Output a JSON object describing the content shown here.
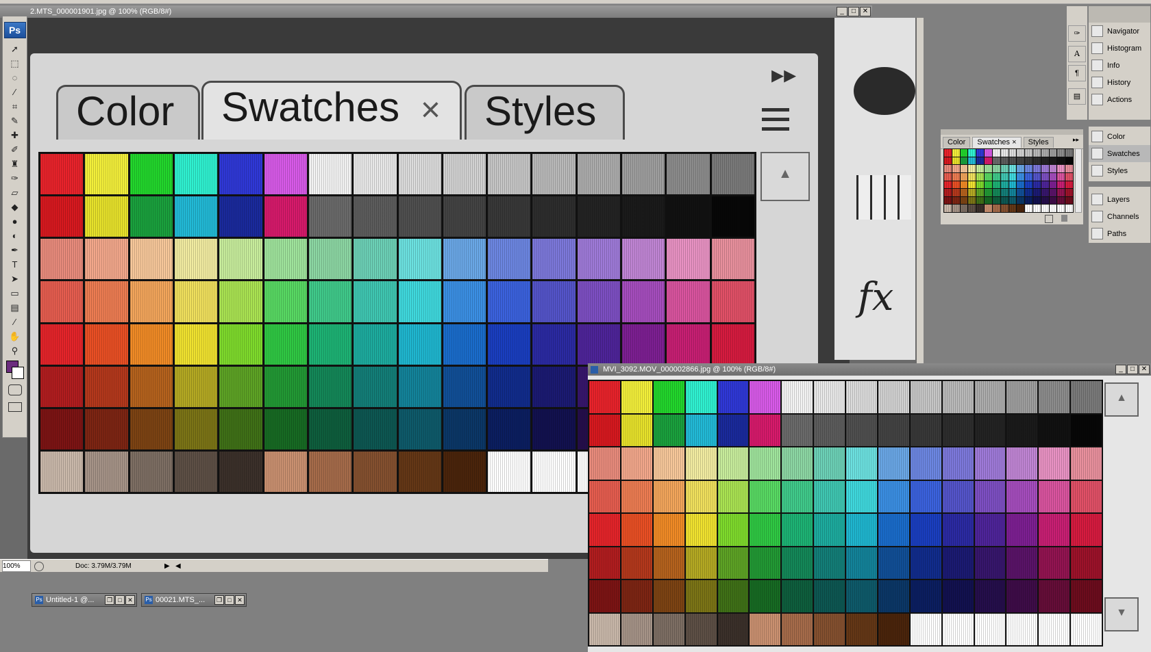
{
  "doc1": {
    "title": "2.MTS_000001901.jpg @ 100% (RGB/8#)",
    "tabs": [
      "Color",
      "Swatches",
      "Styles"
    ],
    "tab_close": "×",
    "panel_menu_glyph": "▸▸",
    "zoom": "100%",
    "doc_info": "Doc: 3.79M/3.79M"
  },
  "doc2": {
    "title": "MVI_3092.MOV_000002866.jpg @ 100% (RGB/8#)"
  },
  "window_buttons": {
    "minimize": "_",
    "maximize": "□",
    "close": "✕"
  },
  "toolbar": {
    "logo": "Ps",
    "tools": [
      {
        "name": "move-tool-icon",
        "glyph": "➚"
      },
      {
        "name": "marquee-tool-icon",
        "glyph": "⬚"
      },
      {
        "name": "lasso-tool-icon",
        "glyph": "◌"
      },
      {
        "name": "magic-wand-tool-icon",
        "glyph": "⁄"
      },
      {
        "name": "crop-tool-icon",
        "glyph": "⌗"
      },
      {
        "name": "slice-tool-icon",
        "glyph": "✎"
      },
      {
        "name": "healing-tool-icon",
        "glyph": "✚"
      },
      {
        "name": "brush-tool-icon",
        "glyph": "✐"
      },
      {
        "name": "stamp-tool-icon",
        "glyph": "♜"
      },
      {
        "name": "history-brush-icon",
        "glyph": "✑"
      },
      {
        "name": "eraser-tool-icon",
        "glyph": "▱"
      },
      {
        "name": "bucket-tool-icon",
        "glyph": "◆"
      },
      {
        "name": "blur-tool-icon",
        "glyph": "●"
      },
      {
        "name": "dodge-tool-icon",
        "glyph": "◐"
      },
      {
        "name": "pen-tool-icon",
        "glyph": "✒"
      },
      {
        "name": "type-tool-icon",
        "glyph": "T"
      },
      {
        "name": "path-select-icon",
        "glyph": "➤"
      },
      {
        "name": "shape-tool-icon",
        "glyph": "▭"
      },
      {
        "name": "notes-tool-icon",
        "glyph": "▤"
      },
      {
        "name": "eyedropper-tool-icon",
        "glyph": "⁄"
      },
      {
        "name": "hand-tool-icon",
        "glyph": "✋"
      },
      {
        "name": "zoom-tool-icon",
        "glyph": "⚲"
      }
    ]
  },
  "dock": {
    "group1": [
      "Navigator",
      "Histogram",
      "Info",
      "History",
      "Actions"
    ],
    "group2": [
      "Color",
      "Swatches",
      "Styles"
    ],
    "group3": [
      "Layers",
      "Channels",
      "Paths"
    ],
    "selected": "Swatches"
  },
  "mini_panel": {
    "tabs": [
      "Color",
      "Swatches",
      "Styles"
    ],
    "tab_close": "×"
  },
  "taskbar": [
    {
      "title": "Untitled-1 @..."
    },
    {
      "title": "00021.MTS_..."
    }
  ],
  "colors": {
    "row1": [
      "#e8232b",
      "#f2ee3a",
      "#22d52c",
      "#2ff0d0",
      "#2f38d6",
      "#d75ae8",
      "#f3f3f3",
      "#e8e8e8",
      "#dcdcdc",
      "#d2d2d2",
      "#c6c6c6",
      "#b9b9b9",
      "#acacac",
      "#9e9e9e",
      "#8c8c8c",
      "#7a7a7a"
    ],
    "row2": [
      "#d7191f",
      "#e6e12b",
      "#1aa03d",
      "#22b9d6",
      "#1a2a9c",
      "#d61a6b",
      "#6a6a6a",
      "#5c5c5c",
      "#4f4f4f",
      "#434343",
      "#383838",
      "#2d2d2d",
      "#232323",
      "#1a1a1a",
      "#111111",
      "#070707"
    ],
    "row3": [
      "#e88b7c",
      "#f2a78b",
      "#f6c79a",
      "#f1eba1",
      "#c7ec9c",
      "#9fe39c",
      "#8cd6a3",
      "#6cd0b6",
      "#6ce1e0",
      "#6aa7e6",
      "#6c86e1",
      "#7c78da",
      "#9e7ad8",
      "#c085d4",
      "#e892c3",
      "#e8909d"
    ],
    "row4": [
      "#e55d4f",
      "#ec7c52",
      "#f2a55b",
      "#efdf5d",
      "#a9e252",
      "#58d863",
      "#40c98a",
      "#3fc6b1",
      "#3fd8dd",
      "#3b8fe3",
      "#3b62dd",
      "#5454c9",
      "#7d4fc2",
      "#a54dbd",
      "#d9549f",
      "#e05067"
    ],
    "row5": [
      "#e4242a",
      "#e84f24",
      "#ef8a26",
      "#efe12f",
      "#7ed92c",
      "#2fc743",
      "#1db274",
      "#1dab9e",
      "#1fb6cf",
      "#1a6ccb",
      "#1a3ebf",
      "#2b2aa2",
      "#4e2499",
      "#7d1f92",
      "#c71f73",
      "#d51b3f"
    ],
    "row6": [
      "#b11d1f",
      "#b3381c",
      "#b4621d",
      "#b3a823",
      "#5da225",
      "#229834",
      "#148758",
      "#137e78",
      "#13839a",
      "#114f97",
      "#112c8c",
      "#1b1a72",
      "#37166c",
      "#5a1368",
      "#921451",
      "#9c122a"
    ],
    "row7": [
      "#7c1414",
      "#7d2513",
      "#7c4313",
      "#7b7416",
      "#3f7017",
      "#176a23",
      "#0e5e3d",
      "#0d5752",
      "#0e5a6a",
      "#0b3767",
      "#0b1e60",
      "#12114f",
      "#250e4b",
      "#3e0c48",
      "#650d38",
      "#6c0c1d"
    ],
    "row8": [
      "#c9b8aa",
      "#a59387",
      "#7d6e63",
      "#5d4f45",
      "#3b302a",
      "#c99070",
      "#a56b4a",
      "#84502f",
      "#643716",
      "#4a240b",
      "#ffffff",
      "#ffffff",
      "#ffffff",
      "#ffffff",
      "#ffffff",
      "#ffffff"
    ]
  }
}
